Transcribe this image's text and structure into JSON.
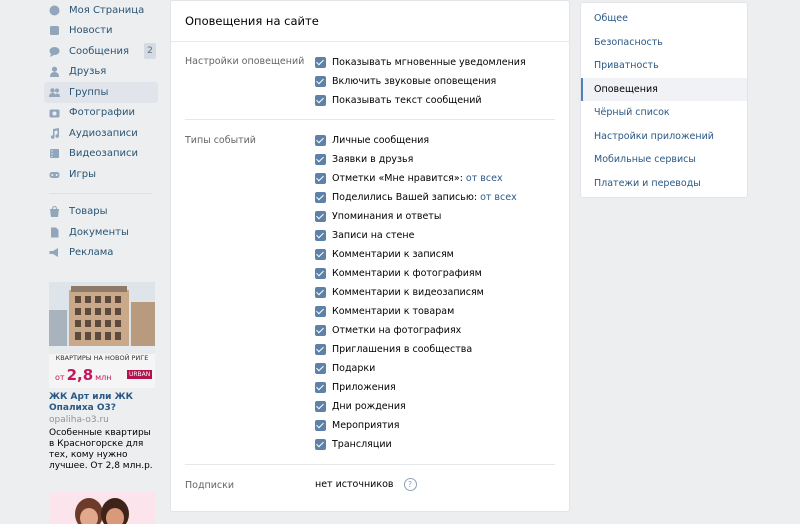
{
  "nav": {
    "items": [
      {
        "label": "Моя Страница",
        "icon": "home-icon"
      },
      {
        "label": "Новости",
        "icon": "news-icon"
      },
      {
        "label": "Сообщения",
        "icon": "messages-icon",
        "badge": "2"
      },
      {
        "label": "Друзья",
        "icon": "friends-icon"
      },
      {
        "label": "Группы",
        "icon": "groups-icon"
      },
      {
        "label": "Фотографии",
        "icon": "photos-icon"
      },
      {
        "label": "Аудиозаписи",
        "icon": "music-icon"
      },
      {
        "label": "Видеозаписи",
        "icon": "video-icon"
      },
      {
        "label": "Игры",
        "icon": "games-icon"
      }
    ],
    "extra": [
      {
        "label": "Товары",
        "icon": "goods-icon"
      },
      {
        "label": "Документы",
        "icon": "docs-icon"
      },
      {
        "label": "Реклама",
        "icon": "ads-icon"
      }
    ]
  },
  "ad1": {
    "banner_line": "КВАРТИРЫ НА НОВОЙ РИГЕ",
    "price_prefix": "от",
    "price": "2,8",
    "price_unit": "млн",
    "brand": "URBAN",
    "title": "ЖК Арт или ЖК Опалиха О3?",
    "domain": "opaliha-o3.ru",
    "text": "Особенные квартиры в Красногорске для тех, кому нужно лучшее. От 2,8 млн.р."
  },
  "main": {
    "title": "Оповещения на сайте",
    "settings_label": "Настройки оповещений",
    "settings": [
      {
        "label": "Показывать мгновенные уведомления"
      },
      {
        "label": "Включить звуковые оповещения"
      },
      {
        "label": "Показывать текст сообщений"
      }
    ],
    "events_label": "Типы событий",
    "events": [
      {
        "label": "Личные сообщения",
        "link": ""
      },
      {
        "label": "Заявки в друзья",
        "link": ""
      },
      {
        "label": "Отметки «Мне нравится»:",
        "link": "от всех"
      },
      {
        "label": "Поделились Вашей записью:",
        "link": "от всех"
      },
      {
        "label": "Упоминания и ответы",
        "link": ""
      },
      {
        "label": "Записи на стене",
        "link": ""
      },
      {
        "label": "Комментарии к записям",
        "link": ""
      },
      {
        "label": "Комментарии к фотографиям",
        "link": ""
      },
      {
        "label": "Комментарии к видеозаписям",
        "link": ""
      },
      {
        "label": "Комментарии к товарам",
        "link": ""
      },
      {
        "label": "Отметки на фотографиях",
        "link": ""
      },
      {
        "label": "Приглашения в сообщества",
        "link": ""
      },
      {
        "label": "Подарки",
        "link": ""
      },
      {
        "label": "Приложения",
        "link": ""
      },
      {
        "label": "Дни рождения",
        "link": ""
      },
      {
        "label": "Мероприятия",
        "link": ""
      },
      {
        "label": "Трансляции",
        "link": ""
      }
    ],
    "subs_label": "Подписки",
    "subs_value": "нет источников",
    "help": "?"
  },
  "right": {
    "items": [
      "Общее",
      "Безопасность",
      "Приватность",
      "Оповещения",
      "Чёрный список",
      "Настройки приложений",
      "Мобильные сервисы",
      "Платежи и переводы"
    ],
    "active_index": 3
  },
  "colors": {
    "accent": "#5181b8",
    "link": "#2a5885",
    "checkbox": "#5e81a8"
  }
}
